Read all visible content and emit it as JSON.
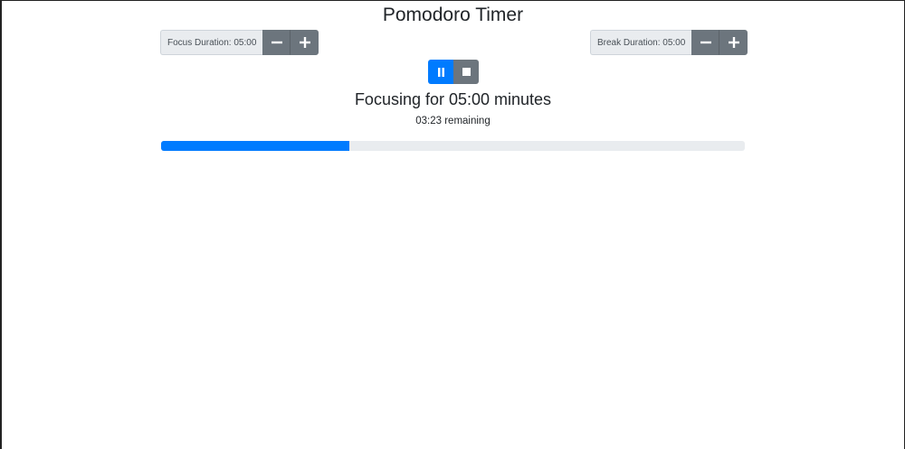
{
  "title": "Pomodoro Timer",
  "focus": {
    "label": "Focus Duration: 05:00",
    "decrease_icon": "minus-icon",
    "increase_icon": "plus-icon"
  },
  "break": {
    "label": "Break Duration: 05:00",
    "decrease_icon": "minus-icon",
    "increase_icon": "plus-icon"
  },
  "controls": {
    "pause_icon": "pause-icon",
    "stop_icon": "stop-icon"
  },
  "status": {
    "heading": "Focusing for 05:00 minutes",
    "remaining": "03:23 remaining"
  },
  "progress": {
    "fraction": 0.323
  },
  "colors": {
    "primary": "#007bff",
    "secondary": "#6c757d",
    "track": "#e9ecef"
  }
}
